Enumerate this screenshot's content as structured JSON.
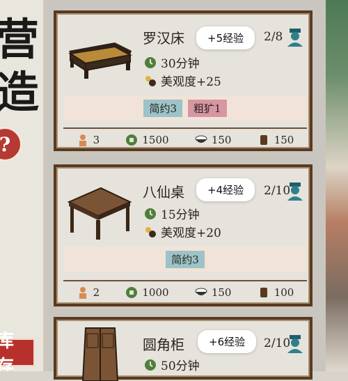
{
  "left_strip": {
    "chars": [
      "营",
      "造"
    ],
    "help_symbol": "?",
    "stamp_text": "库存"
  },
  "cards": [
    {
      "name": "罗汉床",
      "bubble": "+5经验",
      "count": "2/8",
      "time": "30分钟",
      "beauty": "美观度+25",
      "tags": [
        {
          "label": "简约3",
          "color": "#9cc3c7"
        },
        {
          "label": "粗犷1",
          "color": "#d896a2"
        }
      ],
      "costs": {
        "workers": "3",
        "coins": "1500",
        "food": "150",
        "wood": "150"
      }
    },
    {
      "name": "八仙桌",
      "bubble": "+4经验",
      "count": "2/10",
      "time": "15分钟",
      "beauty": "美观度+20",
      "tags": [
        {
          "label": "简约3",
          "color": "#9cc3c7"
        }
      ],
      "costs": {
        "workers": "2",
        "coins": "1000",
        "food": "150",
        "wood": "100"
      }
    },
    {
      "name": "圆角柜",
      "bubble": "+6经验",
      "count": "2/10",
      "time": "50分钟"
    }
  ]
}
